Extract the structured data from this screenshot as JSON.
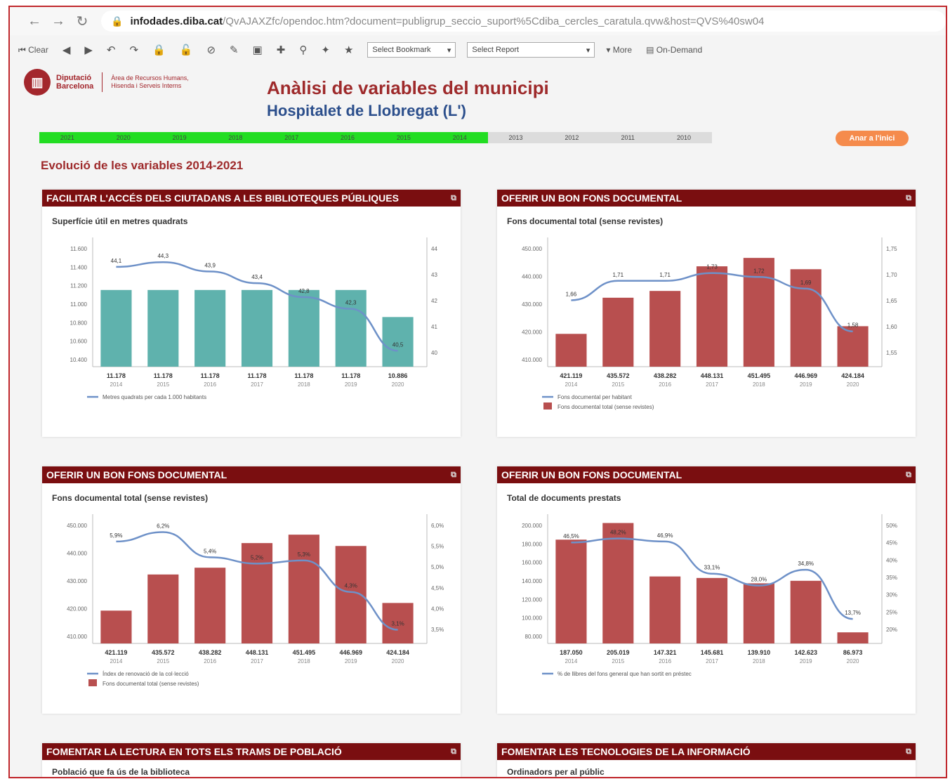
{
  "browser": {
    "back_icon": "back-arrow-icon",
    "forward_icon": "forward-arrow-icon",
    "reload_icon": "reload-icon",
    "url_host": "infodades.diba.cat",
    "url_path": "/QvAJAXZfc/opendoc.htm?document=publigrup_seccio_suport%5Cdiba_cercles_caratula.qvw&host=QVS%40sw04"
  },
  "toolbar": {
    "clear_label": "Clear",
    "bookmark_select": "Select Bookmark",
    "report_select": "Select Report",
    "more_label": "More",
    "ondemand_label": "On-Demand"
  },
  "logo": {
    "name_line1": "Diputació",
    "name_line2": "Barcelona",
    "sub_line1": "Àrea de Recursos Humans,",
    "sub_line2": "Hisenda i Serveis Interns"
  },
  "header": {
    "title": "Anàlisi de variables del municipi",
    "subtitle": "Hospitalet de Llobregat (L')"
  },
  "years": [
    {
      "label": "2021",
      "selected": true
    },
    {
      "label": "2020",
      "selected": true
    },
    {
      "label": "2019",
      "selected": true
    },
    {
      "label": "2018",
      "selected": true
    },
    {
      "label": "2017",
      "selected": true
    },
    {
      "label": "2016",
      "selected": true
    },
    {
      "label": "2015",
      "selected": true
    },
    {
      "label": "2014",
      "selected": true
    },
    {
      "label": "2013",
      "selected": false
    },
    {
      "label": "2012",
      "selected": false
    },
    {
      "label": "2011",
      "selected": false
    },
    {
      "label": "2010",
      "selected": false
    }
  ],
  "home_button": "Anar a l'inici",
  "section_title": "Evolució de les variables 2014-2021",
  "colors": {
    "panel_header": "#7a0e10",
    "teal_bar": "#5fb2ad",
    "red_bar": "#b84f4f",
    "line": "#6e91c8",
    "year_selected": "#22dd22"
  },
  "panels": [
    {
      "heading": "FACILITAR L'ACCÉS DELS CIUTADANS A LES BIBLIOTEQUES PÚBLIQUES",
      "subtitle": "Superfície útil en metres quadrats"
    },
    {
      "heading": "OFERIR UN BON FONS DOCUMENTAL",
      "subtitle": "Fons documental total (sense revistes)"
    },
    {
      "heading": "OFERIR UN BON FONS DOCUMENTAL",
      "subtitle": "Fons documental total (sense revistes)"
    },
    {
      "heading": "OFERIR UN BON FONS DOCUMENTAL",
      "subtitle": "Total de documents prestats"
    },
    {
      "heading": "FOMENTAR LA LECTURA EN TOTS ELS TRAMS DE POBLACIÓ",
      "subtitle": "Població que fa ús de la biblioteca"
    },
    {
      "heading": "FOMENTAR LES TECNOLOGIES DE LA INFORMACIÓ",
      "subtitle": "Ordinadors per al públic"
    }
  ],
  "chart_data": [
    {
      "type": "bar",
      "categories": [
        "2014",
        "2015",
        "2016",
        "2017",
        "2018",
        "2019",
        "2020"
      ],
      "bar_labels": [
        "11.178",
        "11.178",
        "11.178",
        "11.178",
        "11.178",
        "11.178",
        "10.886"
      ],
      "values": [
        11178,
        11178,
        11178,
        11178,
        11178,
        11178,
        10886
      ],
      "bar_color": "#5fb2ad",
      "ylim": [
        10350,
        11700
      ],
      "yticks": [
        "11.600",
        "11.400",
        "11.200",
        "11.000",
        "10.800",
        "10.600",
        "10.400"
      ],
      "line": {
        "name": "Metres quadrats per cada 1.000 habitants",
        "values": [
          44.1,
          44.3,
          43.9,
          43.4,
          42.8,
          42.3,
          40.5
        ],
        "labels": [
          "44,1",
          "44,3",
          "43,9",
          "43,4",
          "42,8",
          "42,3",
          "40,5"
        ],
        "ylim": [
          40,
          45
        ],
        "yticks": [
          "44",
          "43",
          "42",
          "41",
          "40"
        ]
      }
    },
    {
      "type": "bar",
      "categories": [
        "2014",
        "2015",
        "2016",
        "2017",
        "2018",
        "2019",
        "2020"
      ],
      "bar_labels": [
        "421.119",
        "435.572",
        "438.282",
        "448.131",
        "451.495",
        "446.969",
        "424.184"
      ],
      "values": [
        421119,
        435572,
        438282,
        448131,
        451495,
        446969,
        424184
      ],
      "bar_color": "#b84f4f",
      "bar_series_name": "Fons documental total (sense revistes)",
      "ylim": [
        408000,
        458000
      ],
      "yticks": [
        "450.000",
        "440.000",
        "430.000",
        "420.000",
        "410.000"
      ],
      "line": {
        "name": "Fons documental per habitant",
        "values": [
          1.66,
          1.71,
          1.71,
          1.73,
          1.72,
          1.69,
          1.58
        ],
        "labels": [
          "1,66",
          "1,71",
          "1,71",
          "1,73",
          "1,72",
          "1,69",
          "1,58"
        ],
        "ylim": [
          1.5,
          1.8
        ],
        "yticks": [
          "1,75",
          "1,70",
          "1,65",
          "1,60",
          "1,55"
        ]
      }
    },
    {
      "type": "bar",
      "categories": [
        "2014",
        "2015",
        "2016",
        "2017",
        "2018",
        "2019",
        "2020"
      ],
      "bar_labels": [
        "421.119",
        "435.572",
        "438.282",
        "448.131",
        "451.495",
        "446.969",
        "424.184"
      ],
      "values": [
        421119,
        435572,
        438282,
        448131,
        451495,
        446969,
        424184
      ],
      "bar_color": "#b84f4f",
      "bar_series_name": "Fons documental total (sense revistes)",
      "ylim": [
        408000,
        458000
      ],
      "yticks": [
        "450.000",
        "440.000",
        "430.000",
        "420.000",
        "410.000"
      ],
      "line": {
        "name": "Índex de renovació de la col·lecció",
        "values": [
          5.9,
          6.2,
          5.4,
          5.2,
          5.3,
          4.3,
          3.1
        ],
        "labels": [
          "5,9%",
          "6,2%",
          "5,4%",
          "5,2%",
          "5,3%",
          "4,3%",
          "3,1%"
        ],
        "ylim": [
          2.8,
          6.5
        ],
        "yticks": [
          "6,0%",
          "5,5%",
          "5,0%",
          "4,5%",
          "4,0%",
          "3,5%"
        ]
      }
    },
    {
      "type": "bar",
      "categories": [
        "2014",
        "2015",
        "2016",
        "2017",
        "2018",
        "2019",
        "2020"
      ],
      "bar_labels": [
        "187.050",
        "205.019",
        "147.321",
        "145.681",
        "139.910",
        "142.623",
        "86.973"
      ],
      "values": [
        187050,
        205019,
        147321,
        145681,
        139910,
        142623,
        86973
      ],
      "bar_color": "#b84f4f",
      "ylim": [
        75000,
        210000
      ],
      "yticks": [
        "200.000",
        "180.000",
        "160.000",
        "140.000",
        "120.000",
        "100.000",
        "80.000"
      ],
      "line": {
        "name": "% de llibres del fons general que han sortit en préstec",
        "values": [
          46.5,
          48.2,
          46.9,
          33.1,
          28.0,
          34.8,
          13.7
        ],
        "labels": [
          "46,5%",
          "48,2%",
          "46,9%",
          "33,1%",
          "28,0%",
          "34,8%",
          "13,7%"
        ],
        "ylim": [
          5,
          55
        ],
        "yticks": [
          "50%",
          "45%",
          "40%",
          "35%",
          "30%",
          "25%",
          "20%"
        ]
      }
    }
  ]
}
